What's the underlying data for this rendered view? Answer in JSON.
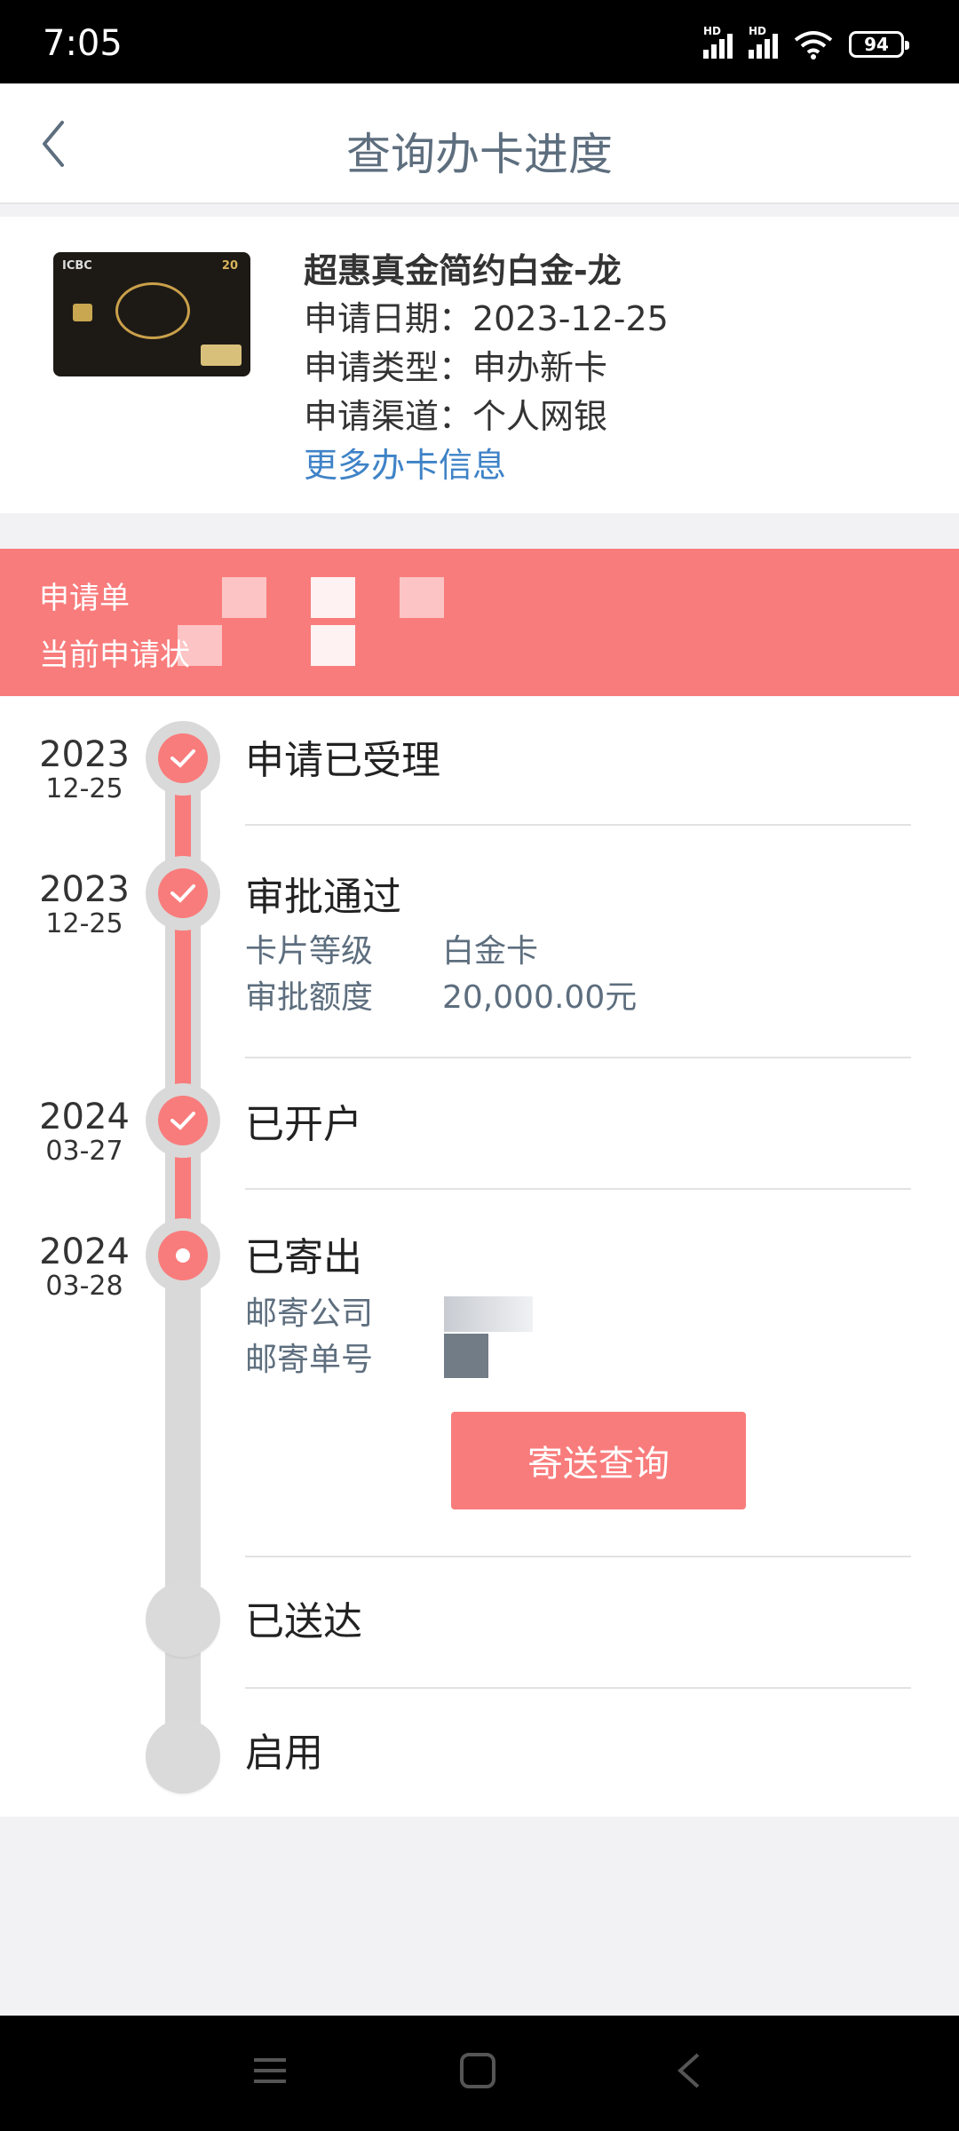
{
  "status_bar": {
    "time": "7:05",
    "battery": "94",
    "hd1": "HD",
    "hd2": "HD"
  },
  "header": {
    "title": "查询办卡进度"
  },
  "card": {
    "name": "超惠真金简约白金-龙",
    "image_brand": "ICBC",
    "image_number": "20",
    "rows": [
      "申请日期：2023-12-25",
      "申请类型：申办新卡",
      "申请渠道：个人网银"
    ],
    "more_link": "更多办卡信息"
  },
  "application": {
    "line1": "申请单",
    "line2": "当前申请状"
  },
  "timeline": [
    {
      "year": "2023",
      "md": "12-25",
      "title": "申请已受理"
    },
    {
      "year": "2023",
      "md": "12-25",
      "title": "审批通过",
      "details": [
        {
          "key": "卡片等级",
          "value": "白金卡"
        },
        {
          "key": "审批额度",
          "value": "20,000.00元"
        }
      ]
    },
    {
      "year": "2024",
      "md": "03-27",
      "title": "已开户"
    },
    {
      "year": "2024",
      "md": "03-28",
      "title": "已寄出",
      "details": [
        {
          "key": "邮寄公司",
          "value": ""
        },
        {
          "key": "邮寄单号",
          "value": ""
        }
      ]
    },
    {
      "title": "已送达"
    },
    {
      "title": "启用"
    }
  ],
  "track_button": "寄送查询",
  "colors": {
    "accent": "#f97c7c",
    "title": "#5d6e7e",
    "link": "#3f83c7"
  }
}
